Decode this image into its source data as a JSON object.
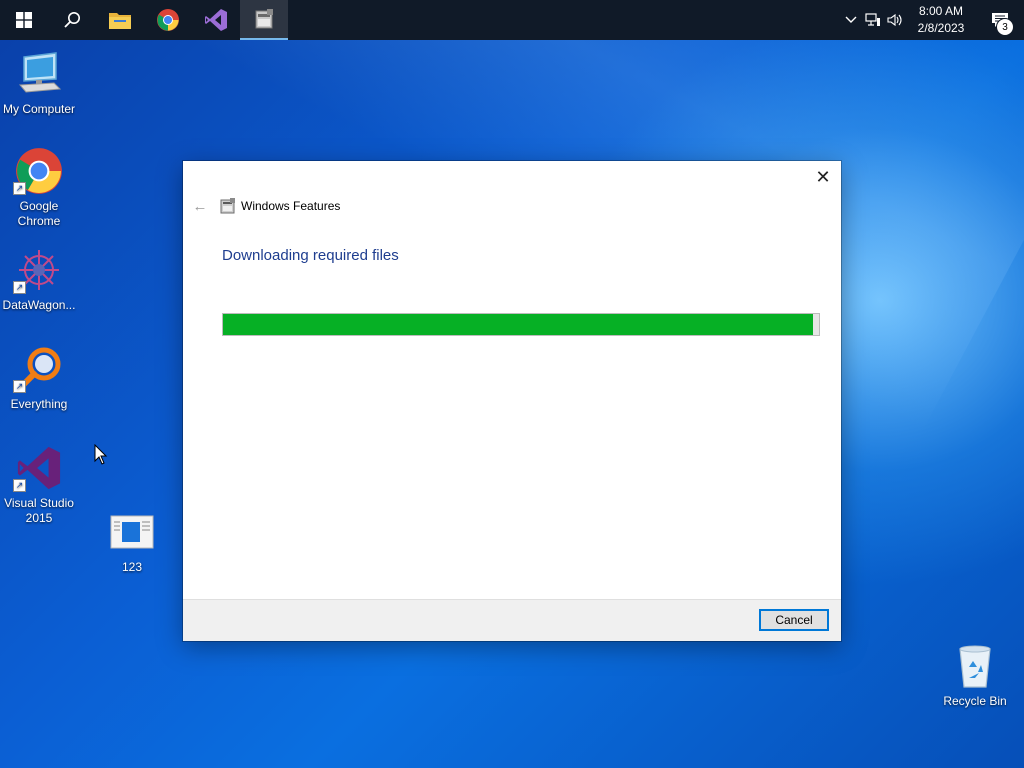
{
  "taskbar": {
    "apps": [
      {
        "name": "start",
        "icon": "windows-logo-icon"
      },
      {
        "name": "search",
        "icon": "search-icon"
      },
      {
        "name": "file-explorer",
        "icon": "folder-icon"
      },
      {
        "name": "chrome",
        "icon": "chrome-icon"
      },
      {
        "name": "visual-studio",
        "icon": "visual-studio-icon"
      },
      {
        "name": "windows-features",
        "icon": "windows-features-icon",
        "active": true
      }
    ],
    "tray": {
      "time": "8:00 AM",
      "date": "2/8/2023",
      "notification_count": "3"
    }
  },
  "desktop_icons": [
    {
      "label": "My Computer",
      "icon": "computer-icon"
    },
    {
      "label": "Google Chrome",
      "icon": "chrome-icon"
    },
    {
      "label": "DataWagon...",
      "icon": "datawagon-icon"
    },
    {
      "label": "Everything",
      "icon": "everything-search-icon"
    },
    {
      "label": "Visual Studio 2015",
      "icon": "visual-studio-icon"
    },
    {
      "label": "123",
      "icon": "document-icon"
    },
    {
      "label": "Recycle Bin",
      "icon": "recycle-bin-icon"
    }
  ],
  "dialog": {
    "title": "Windows Features",
    "heading": "Downloading required files",
    "progress_fraction": 0.99,
    "cancel_label": "Cancel"
  },
  "colors": {
    "progress_fill": "#06b025",
    "heading": "#1e3d8f",
    "taskbar": "#101a28",
    "accent": "#0078d7"
  }
}
